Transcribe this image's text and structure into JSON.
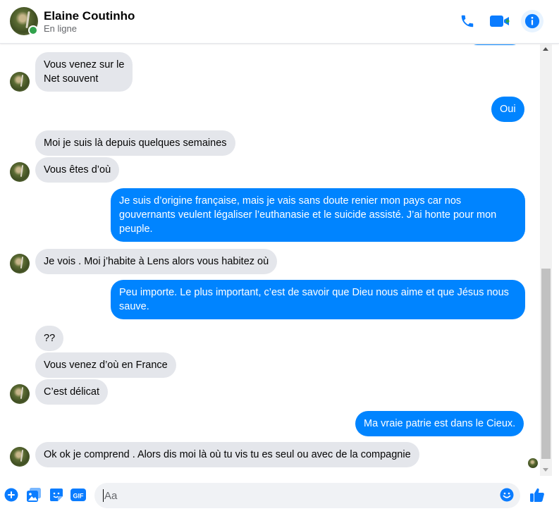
{
  "header": {
    "name": "Elaine Coutinho",
    "status": "En ligne"
  },
  "messages": [
    {
      "from": "them",
      "text": "Vous venez sur le Net souvent",
      "line1": "Vous venez sur le",
      "line2": "Net souvent"
    },
    {
      "from": "me",
      "text": "Oui"
    },
    {
      "from": "them",
      "text": "Moi je suis là depuis quelques semaines"
    },
    {
      "from": "them",
      "text": "Vous êtes d’où"
    },
    {
      "from": "me",
      "line1": "Je suis d’origine française, mais je vais sans doute renier mon pays car nos",
      "line2": "gouvernants veulent légaliser l’euthanasie et le suicide assisté. J’ai honte pour mon",
      "line3": "peuple."
    },
    {
      "from": "them",
      "text": "Je vois . Moi j’habite à Lens alors vous habitez où"
    },
    {
      "from": "me",
      "line1": "Peu importe. Le plus important, c’est de savoir que Dieu nous aime et que Jésus nous",
      "line2": "sauve."
    },
    {
      "from": "them",
      "text": "??"
    },
    {
      "from": "them",
      "text": "Vous venez d’où en France"
    },
    {
      "from": "them",
      "text": "C’est délicat"
    },
    {
      "from": "me",
      "text": "Ma vraie patrie est dans le Cieux."
    },
    {
      "from": "them",
      "text": "Ok ok je comprend . Alors dis moi là où tu vis tu es seul ou avec de la compagnie"
    }
  ],
  "composer": {
    "placeholder": "Aa",
    "gif_label": "GIF"
  },
  "colors": {
    "accent": "#0084ff",
    "incoming_bubble": "#e4e6eb",
    "online": "#31a24c",
    "icon_blue": "#0a7cff"
  },
  "icons": [
    "phone-icon",
    "video-camera-icon",
    "info-icon",
    "plus-icon",
    "image-icon",
    "sticker-icon",
    "gif-icon",
    "emoji-icon",
    "thumbs-up-icon"
  ]
}
